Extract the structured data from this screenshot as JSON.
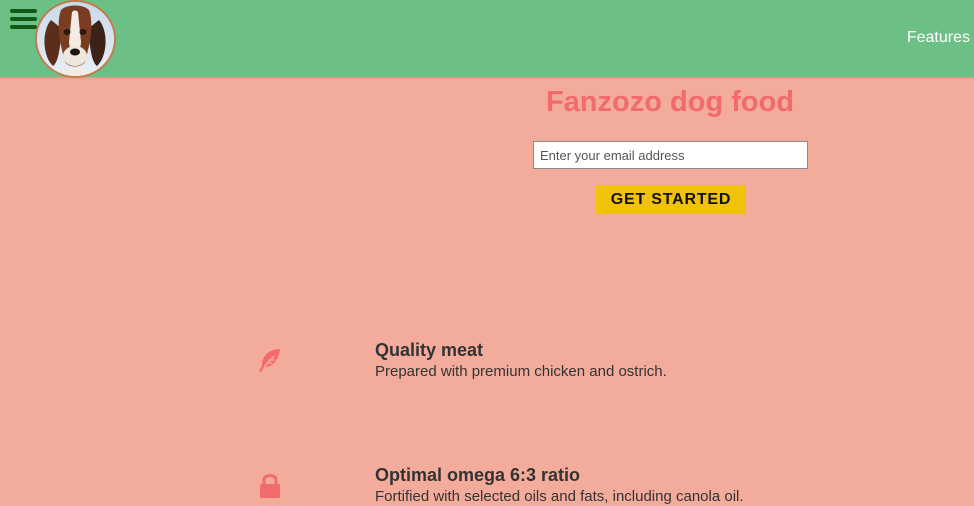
{
  "header": {
    "nav_features": "Features",
    "logo_icon": "basset-hound-dog-icon",
    "menu_icon": "hamburger-menu-icon"
  },
  "hero": {
    "title": "Fanzozo dog food",
    "email_placeholder": "Enter your email address",
    "cta_label": "GET STARTED"
  },
  "features": [
    {
      "icon": "feather-icon",
      "title": "Quality meat",
      "description": "Prepared with premium chicken and ostrich."
    },
    {
      "icon": "lock-icon",
      "title": "Optimal omega 6:3 ratio",
      "description": "Fortified with selected oils and fats, including canola oil."
    }
  ],
  "colors": {
    "header_bg": "#6cc085",
    "page_bg": "#f3ab9b",
    "accent": "#f26a6a",
    "cta_bg": "#f0c20a",
    "menu_icon": "#0f5a17"
  }
}
